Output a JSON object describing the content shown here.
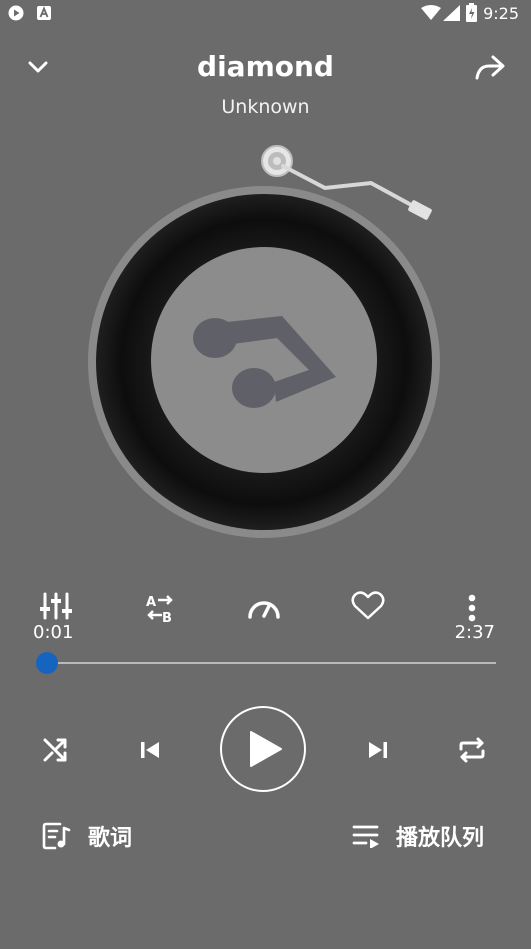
{
  "status_bar": {
    "time": "9:25",
    "icons": [
      "play-icon",
      "font-icon",
      "wifi-icon",
      "signal-icon",
      "battery-icon"
    ]
  },
  "header": {
    "title": "diamond",
    "artist": "Unknown",
    "collapse_icon": "chevron-down-icon",
    "share_icon": "share-icon"
  },
  "player": {
    "current_time": "0:01",
    "duration": "2:37",
    "progress_fraction": 0.006
  },
  "tools": [
    "equalizer-icon",
    "ab-repeat-icon",
    "speed-icon",
    "heart-icon",
    "more-icon"
  ],
  "bottom": {
    "lyrics_label": "歌词",
    "queue_label": "播放队列"
  },
  "colors": {
    "background": "#6b6b6b",
    "accent": "#1565c0"
  }
}
